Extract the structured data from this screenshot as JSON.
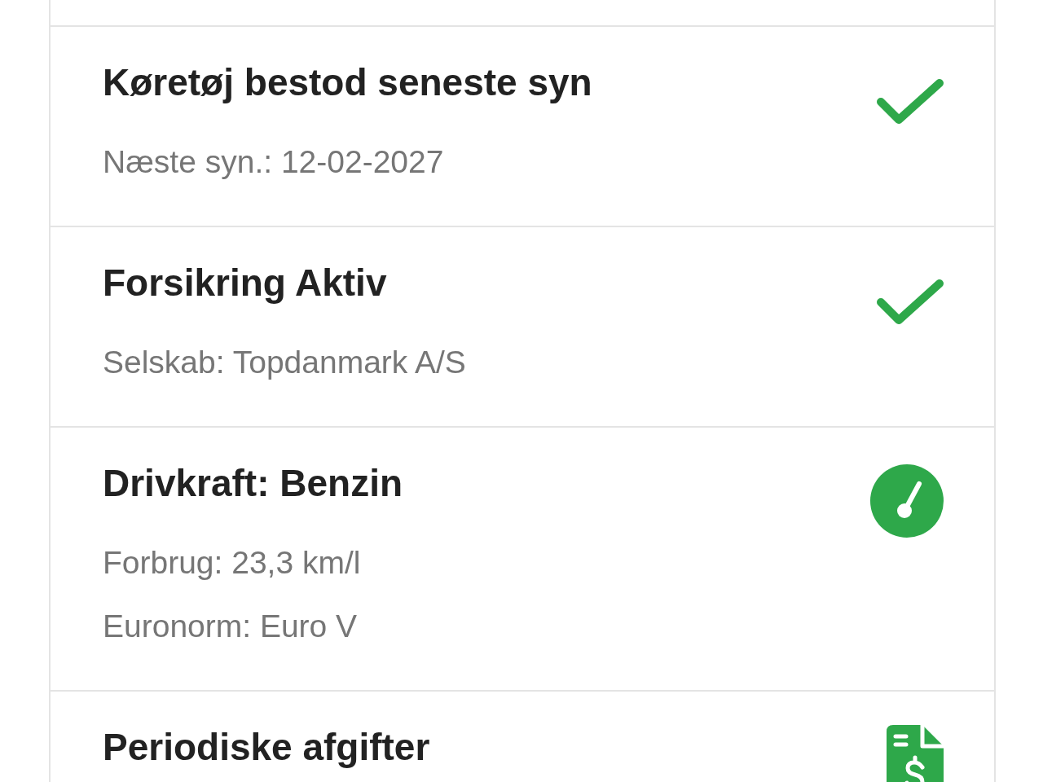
{
  "cards": [
    {
      "title": "Køretøj bestod seneste syn",
      "details": [
        "Næste syn.: 12-02-2027"
      ],
      "kind": "check"
    },
    {
      "title": "Forsikring Aktiv",
      "details": [
        "Selskab: Topdanmark A/S"
      ],
      "kind": "check"
    },
    {
      "title": "Drivkraft: Benzin",
      "details": [
        "Forbrug: 23,3 km/l",
        "Euronorm: Euro V"
      ],
      "kind": "gauge"
    },
    {
      "title": "Periodiske afgifter",
      "kind": "invoice"
    }
  ]
}
